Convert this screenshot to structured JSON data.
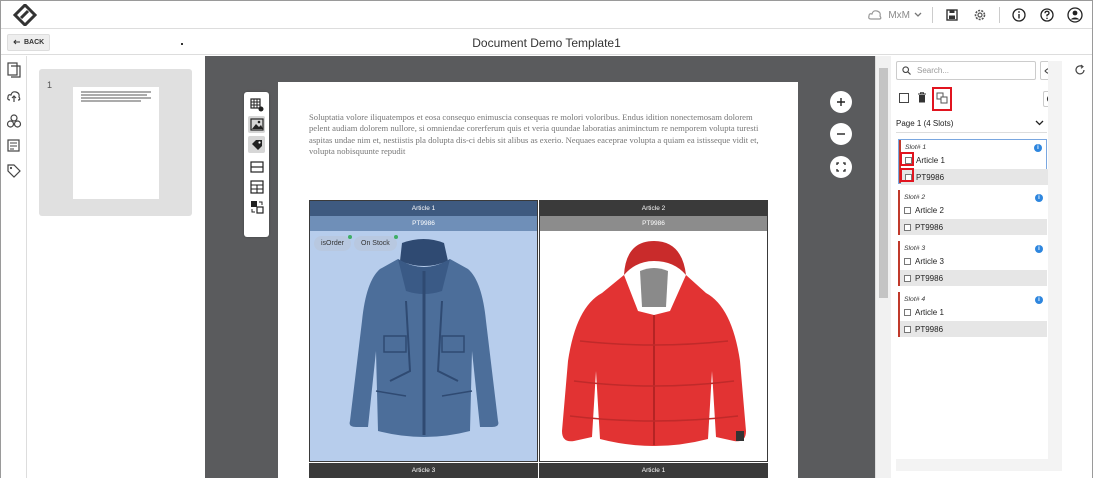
{
  "header": {
    "user": "MxM",
    "icons": [
      "logo-icon",
      "cloud-user-icon",
      "chevron-down-icon",
      "save-icon",
      "gear-icon",
      "info-icon",
      "help-icon",
      "account-icon"
    ]
  },
  "titlebar": {
    "back_label": "BACK",
    "title": "Document Demo Template1"
  },
  "pages_panel": {
    "pages": [
      {
        "number": "1"
      }
    ]
  },
  "document": {
    "paragraph": "Soluptatia volore iliquatempos et eosa consequo enimuscia consequas re molori voloribus. Endus idition nonectemosam dolorem pelent audiam dolorem nullore, si omniendae corerferum quis et veria quundae laboratias animinctum re nemporem volupta turesti aspitas undae nim et, nestiistis pla dolupta dis-ci debis sit alibus as exerio. Nequaes eaceprae volupta a quiam ea istisseque vidit et, volupta nobisquunte repudit",
    "cells": [
      {
        "article": "Article 1",
        "pt": "PT9986",
        "tags": [
          "isOrder",
          "On Stock"
        ],
        "selected": true,
        "jacket": "blue"
      },
      {
        "article": "Article 2",
        "pt": "PT9986",
        "tags": [],
        "selected": false,
        "jacket": "red"
      }
    ],
    "bottom_cells": [
      {
        "article": "Article 3"
      },
      {
        "article": "Article 1"
      }
    ]
  },
  "right_panel": {
    "search_placeholder": "Search...",
    "page_select": "Page 1 (4 Slots)",
    "slots": [
      {
        "title": "Slot# 1",
        "article": "Article 1",
        "pt": "PT9986"
      },
      {
        "title": "Slot# 2",
        "article": "Article 2",
        "pt": "PT9986"
      },
      {
        "title": "Slot# 3",
        "article": "Article 3",
        "pt": "PT9986"
      },
      {
        "title": "Slot# 4",
        "article": "Article 1",
        "pt": "PT9986"
      }
    ]
  },
  "colors": {
    "accent_red": "#e1141f",
    "slot_bar": "#c0392b",
    "selected_header_dark": "#3e5a80",
    "selected_header_light": "#6f8fb8",
    "selected_bg": "#b7cdec",
    "dark_header": "#3a3a3a",
    "grey_header": "#8c8c8c",
    "canvas_bg": "#5a5b5d"
  }
}
